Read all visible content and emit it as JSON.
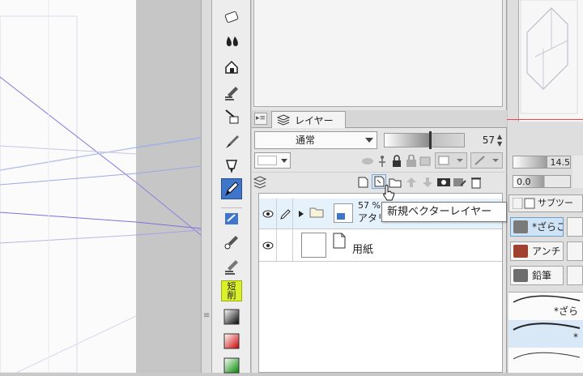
{
  "layer_panel": {
    "tab_label": "レイヤー",
    "blend_mode": "通常",
    "opacity": "57",
    "layers": [
      {
        "opacity_label": "57 %",
        "name_label": "アタリ",
        "type": "folder"
      },
      {
        "name_label": "用紙",
        "type": "paper"
      }
    ]
  },
  "tooltip": {
    "text": "新規ベクターレイヤー"
  },
  "tool_palette": {
    "tools": [
      "eraser-icon",
      "fill-icon",
      "house-fill-icon",
      "blend-brush-icon",
      "ink-bottle-icon",
      "brush-icon",
      "marker-icon",
      "pen-icon",
      "paint-bucket-icon",
      "airbrush-icon",
      "smudge-icon",
      "shortcut-delete-icon",
      "black-square-icon",
      "red-gradient-icon",
      "green-gradient-icon"
    ],
    "shortcut_label": "短削"
  },
  "brush_property": {
    "size": "14.5",
    "density": "0.0"
  },
  "sub_tool": {
    "tab_label": "サブツー",
    "items": [
      {
        "label": "*ざらこ"
      },
      {
        "label": "アンチ"
      },
      {
        "label": "鉛筆"
      }
    ],
    "strokes": [
      "*ざら",
      "*"
    ]
  },
  "colors": {
    "active_blue": "#3f76c9",
    "selected_row": "#e6f2fb",
    "guide_purple": "#7f6fdc"
  }
}
